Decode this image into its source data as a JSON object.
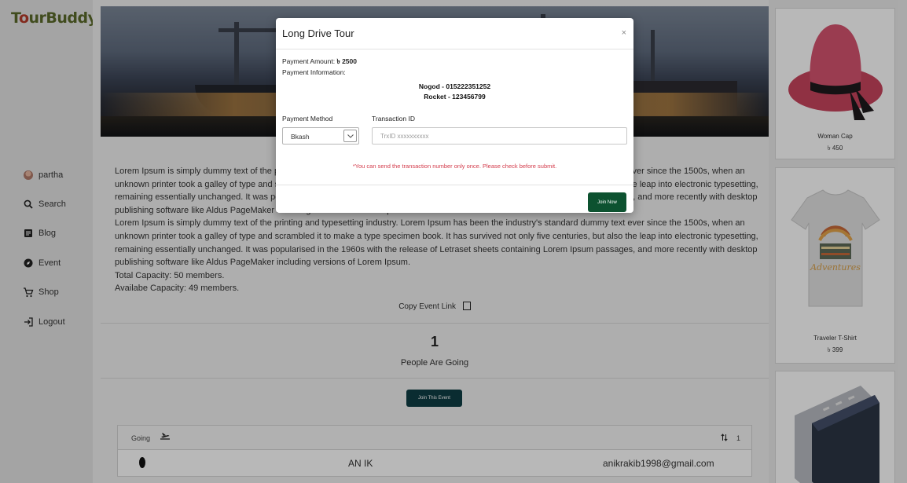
{
  "brand": {
    "logo_text": "TourBuddy"
  },
  "sidebar": {
    "items": [
      {
        "label": "partha",
        "icon": "avatar"
      },
      {
        "label": "Search",
        "icon": "search-icon"
      },
      {
        "label": "Blog",
        "icon": "blog-icon"
      },
      {
        "label": "Event",
        "icon": "compass-icon"
      },
      {
        "label": "Shop",
        "icon": "cart-icon"
      },
      {
        "label": "Logout",
        "icon": "logout-icon"
      }
    ]
  },
  "event": {
    "paragraph_1": "Lorem Ipsum is simply dummy text of the printing and typesetting industry. Lorem Ipsum has been the industry's standard dummy text ever since the 1500s, when an unknown printer took a galley of type and scrambled it to make a type specimen book. It has survived not only five centuries, but also the leap into electronic typesetting, remaining essentially unchanged. It was popularised in the 1960s with the release of Letraset sheets containing Lorem Ipsum passages, and more recently with desktop publishing software like Aldus PageMaker including versions of Lorem Ipsum.",
    "paragraph_2": "Lorem Ipsum is simply dummy text of the printing and typesetting industry. Lorem Ipsum has been the industry's standard dummy text ever since the 1500s, when an unknown printer took a galley of type and scrambled it to make a type specimen book. It has survived not only five centuries, but also the leap into electronic typesetting, remaining essentially unchanged. It was popularised in the 1960s with the release of Letraset sheets containing Lorem Ipsum passages, and more recently with desktop publishing software like Aldus PageMaker including versions of Lorem Ipsum.",
    "total_capacity": "Total Capacity: 50 members.",
    "available_capacity": "Availabe Capacity: 49 members.",
    "copy_link_label": "Copy Event Link",
    "going_count": "1",
    "going_label": "People Are Going",
    "join_button": "Join This Event"
  },
  "going_table": {
    "header_label": "Going",
    "sort_icon": "sort-icon",
    "count": "1",
    "rows": [
      {
        "name": "AN IK",
        "email": "anikrakib1998@gmail.com"
      }
    ]
  },
  "shop": {
    "products": [
      {
        "name": "Woman Cap",
        "price": "৳ 450"
      },
      {
        "name": "Traveler T-Shirt",
        "price": "৳ 399"
      },
      {
        "name": "",
        "price": ""
      }
    ]
  },
  "modal": {
    "title": "Long Drive Tour",
    "close": "×",
    "payment_amount_label": "Payment Amount:",
    "payment_amount_value": "৳ 2500",
    "payment_info_label": "Payment Information:",
    "nogod": "Nogod - 015222351252",
    "rocket": "Rocket - 123456799",
    "method_label": "Payment Method",
    "method_value": "Bkash",
    "trx_label": "Transaction ID",
    "trx_placeholder": "TrxID xxxxxxxxxx",
    "trx_value": "",
    "warning": "*You can send the transaction number only once. Please check before submit.",
    "submit": "Join Now"
  },
  "colors": {
    "accent_dark_teal": "#0f3d45",
    "join_now_green": "#0d5230",
    "warning_red": "#d33a4a"
  }
}
